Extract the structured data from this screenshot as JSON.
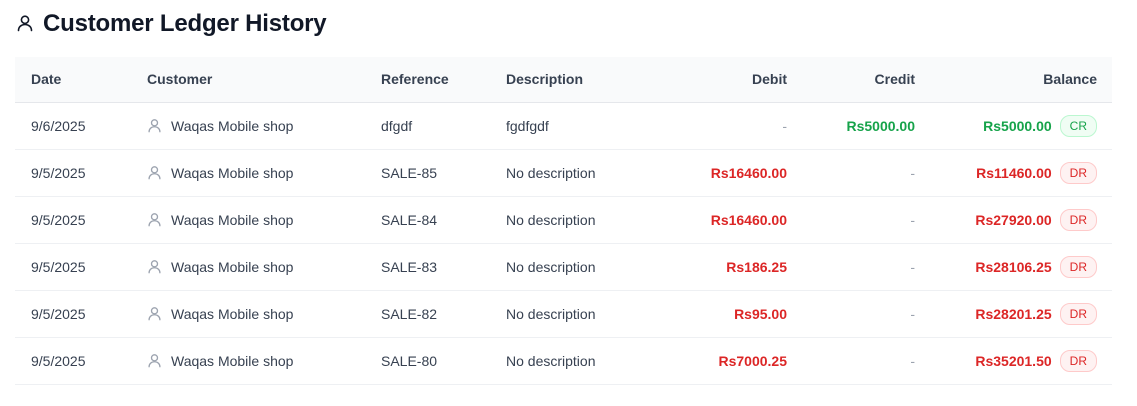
{
  "page": {
    "title": "Customer Ledger History",
    "title_icon": "user-icon"
  },
  "table": {
    "headers": {
      "date": "Date",
      "customer": "Customer",
      "reference": "Reference",
      "description": "Description",
      "debit": "Debit",
      "credit": "Credit",
      "balance": "Balance"
    },
    "rows": [
      {
        "date": "9/6/2025",
        "customer": "Waqas Mobile shop",
        "reference": "dfgdf",
        "description": "fgdfgdf",
        "debit": "-",
        "credit": "Rs5000.00",
        "balance": "Rs5000.00",
        "badge": "CR"
      },
      {
        "date": "9/5/2025",
        "customer": "Waqas Mobile shop",
        "reference": "SALE-85",
        "description": "No description",
        "debit": "Rs16460.00",
        "credit": "-",
        "balance": "Rs11460.00",
        "badge": "DR"
      },
      {
        "date": "9/5/2025",
        "customer": "Waqas Mobile shop",
        "reference": "SALE-84",
        "description": "No description",
        "debit": "Rs16460.00",
        "credit": "-",
        "balance": "Rs27920.00",
        "badge": "DR"
      },
      {
        "date": "9/5/2025",
        "customer": "Waqas Mobile shop",
        "reference": "SALE-83",
        "description": "No description",
        "debit": "Rs186.25",
        "credit": "-",
        "balance": "Rs28106.25",
        "badge": "DR"
      },
      {
        "date": "9/5/2025",
        "customer": "Waqas Mobile shop",
        "reference": "SALE-82",
        "description": "No description",
        "debit": "Rs95.00",
        "credit": "-",
        "balance": "Rs28201.25",
        "badge": "DR"
      },
      {
        "date": "9/5/2025",
        "customer": "Waqas Mobile shop",
        "reference": "SALE-80",
        "description": "No description",
        "debit": "Rs7000.25",
        "credit": "-",
        "balance": "Rs35201.50",
        "badge": "DR"
      }
    ]
  },
  "colors": {
    "debit": "#dc2626",
    "credit": "#16a34a",
    "header_bg": "#f9fafb"
  }
}
